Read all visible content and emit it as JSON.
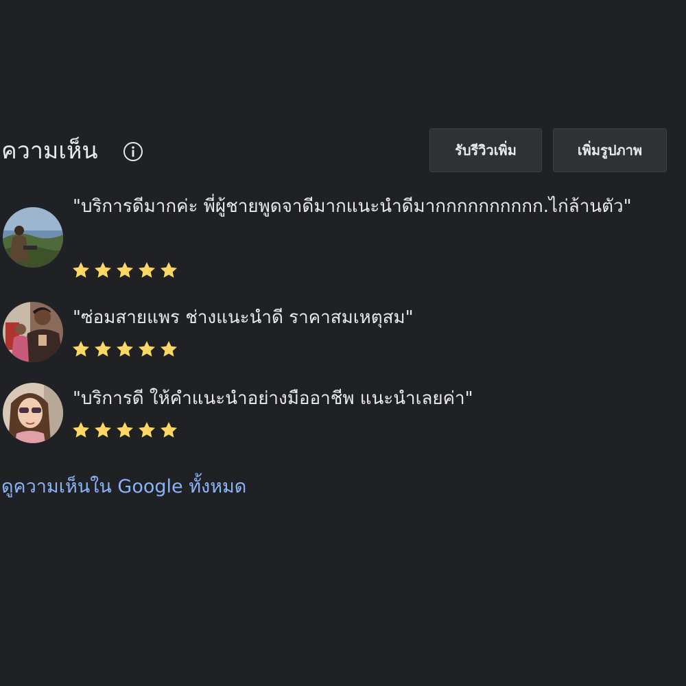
{
  "header": {
    "title": "ความเห็น",
    "info_icon": "info-icon",
    "buttons": {
      "get_more_reviews": "รับรีวิวเพิ่ม",
      "add_photos": "เพิ่มรูปภาพ"
    }
  },
  "reviews": [
    {
      "text": "\"บริการดีมากค่ะ พี่ผู้ชายพูดจาดีมากแนะนำดีมากกกกกกกกกก.ไก่ล้านตัว\"",
      "rating": 5,
      "max_rating": 5
    },
    {
      "text": "\"ซ่อมสายแพร ช่างแนะนำดี ราคาสมเหตุสม\"",
      "rating": 5,
      "max_rating": 5
    },
    {
      "text": "\"บริการดี ให้คำแนะนำอย่างมืออาชีพ แนะนำเลยค่า\"",
      "rating": 5,
      "max_rating": 5
    }
  ],
  "footer": {
    "view_all_link": "ดูความเห็นใน Google ทั้งหมด"
  },
  "colors": {
    "background": "#202124",
    "text": "#e8eaed",
    "button_bg": "#303134",
    "star": "#fdd663",
    "link": "#8ab4f8"
  }
}
